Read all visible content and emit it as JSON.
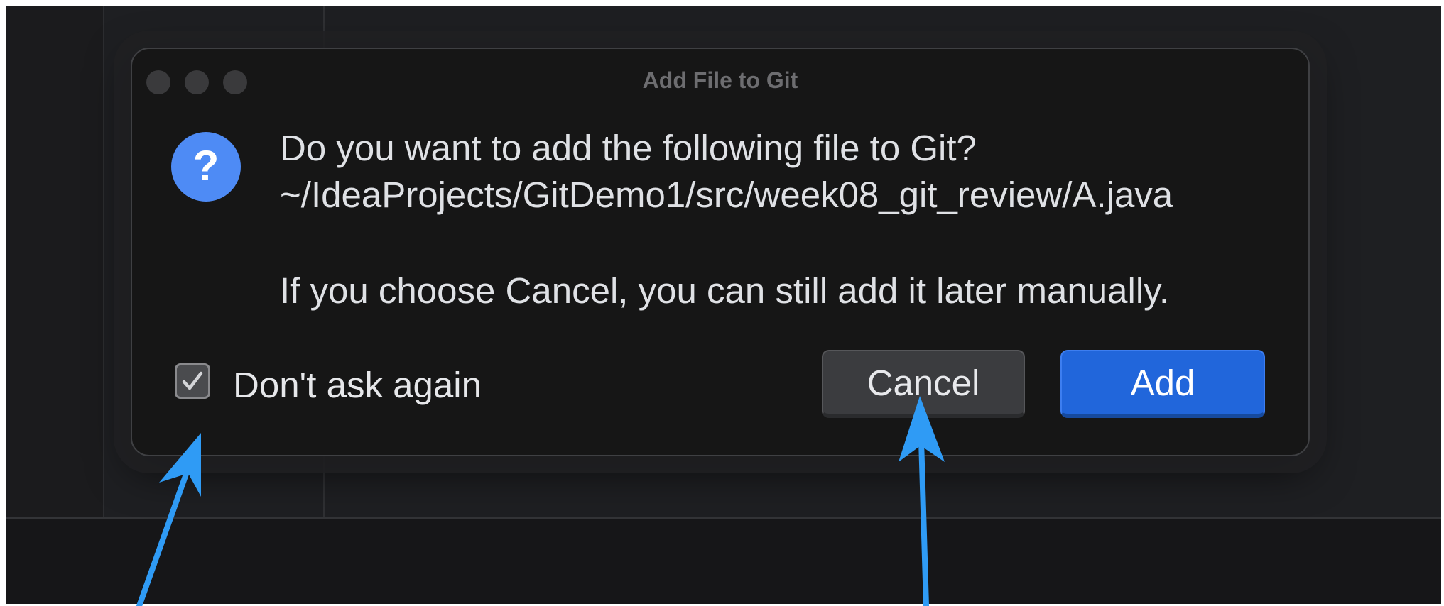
{
  "dialog": {
    "title": "Add File to Git",
    "question": "Do you want to add the following file to Git?",
    "file_path": "~/IdeaProjects/GitDemo1/src/week08_git_review/A.java",
    "note": "If you choose Cancel, you can still add it later manually.",
    "checkbox_label": "Don't ask again",
    "checkbox_checked": true,
    "cancel_label": "Cancel",
    "add_label": "Add",
    "icon": "question-icon"
  },
  "colors": {
    "accent": "#2166db",
    "question_icon": "#4e8bf5",
    "annotation_arrow": "#2f9bf5",
    "dialog_bg": "#161616"
  }
}
